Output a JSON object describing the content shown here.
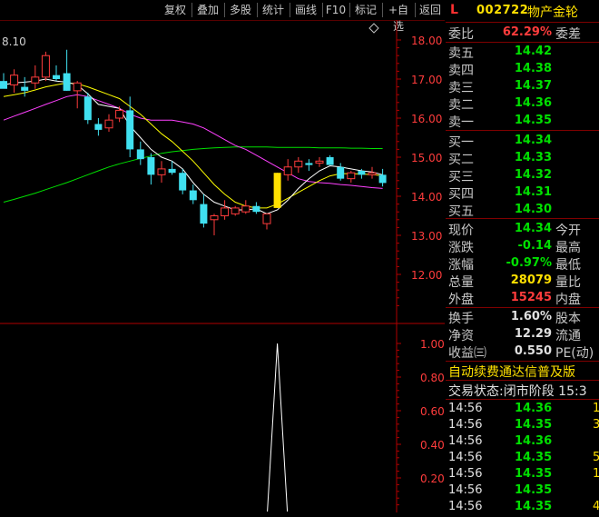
{
  "toolbar": {
    "buttons": [
      "复权",
      "叠加",
      "多股",
      "统计",
      "画线",
      "F10",
      "标记",
      "+自选",
      "返回"
    ]
  },
  "chart": {
    "top_left_label": "8.10",
    "corner_icon": "diamond-icon",
    "price_axis": [
      "18.00",
      "17.00",
      "16.00",
      "15.00",
      "14.00",
      "13.00",
      "12.00"
    ],
    "indicator_axis": [
      "1.00",
      "0.80",
      "0.60",
      "0.40",
      "0.20"
    ],
    "colors": {
      "up": "#ff3c3c",
      "down": "#40e0f0",
      "ma5": "#ffffff",
      "ma10": "#ffff00",
      "ma20": "#ff40ff",
      "ma60": "#00e000",
      "highlight": "#ffe000",
      "axis": "#b00000"
    }
  },
  "chart_data": {
    "type": "candlestick",
    "ylim": [
      11.5,
      18.2
    ],
    "candles": [
      {
        "o": 16.95,
        "h": 17.15,
        "l": 16.85,
        "c": 16.75
      },
      {
        "o": 16.85,
        "h": 17.25,
        "l": 16.65,
        "c": 17.1
      },
      {
        "o": 16.8,
        "h": 17.05,
        "l": 16.55,
        "c": 16.7
      },
      {
        "o": 16.9,
        "h": 17.35,
        "l": 16.75,
        "c": 17.05
      },
      {
        "o": 17.05,
        "h": 17.7,
        "l": 16.95,
        "c": 17.6
      },
      {
        "o": 17.1,
        "h": 17.35,
        "l": 16.95,
        "c": 17.0
      },
      {
        "o": 17.15,
        "h": 17.75,
        "l": 16.7,
        "c": 16.7
      },
      {
        "o": 16.7,
        "h": 16.95,
        "l": 16.25,
        "c": 16.9
      },
      {
        "o": 16.55,
        "h": 16.65,
        "l": 15.85,
        "c": 15.95
      },
      {
        "o": 15.85,
        "h": 16.0,
        "l": 15.55,
        "c": 15.7
      },
      {
        "o": 15.75,
        "h": 16.1,
        "l": 15.65,
        "c": 15.95
      },
      {
        "o": 16.0,
        "h": 16.3,
        "l": 15.9,
        "c": 16.2
      },
      {
        "o": 16.2,
        "h": 16.55,
        "l": 15.0,
        "c": 15.2
      },
      {
        "o": 15.2,
        "h": 15.4,
        "l": 14.8,
        "c": 14.95
      },
      {
        "o": 15.0,
        "h": 15.1,
        "l": 14.3,
        "c": 14.55
      },
      {
        "o": 14.55,
        "h": 14.9,
        "l": 14.35,
        "c": 14.7
      },
      {
        "o": 14.7,
        "h": 14.9,
        "l": 14.55,
        "c": 14.6
      },
      {
        "o": 14.6,
        "h": 14.7,
        "l": 14.05,
        "c": 14.15
      },
      {
        "o": 14.15,
        "h": 14.3,
        "l": 13.8,
        "c": 13.9
      },
      {
        "o": 13.8,
        "h": 14.05,
        "l": 13.2,
        "c": 13.3
      },
      {
        "o": 13.4,
        "h": 13.55,
        "l": 13.0,
        "c": 13.5
      },
      {
        "o": 13.5,
        "h": 13.9,
        "l": 13.4,
        "c": 13.7
      },
      {
        "o": 13.55,
        "h": 13.75,
        "l": 13.5,
        "c": 13.7
      },
      {
        "o": 13.6,
        "h": 13.9,
        "l": 13.55,
        "c": 13.75
      },
      {
        "o": 13.75,
        "h": 13.85,
        "l": 13.55,
        "c": 13.6
      },
      {
        "o": 13.3,
        "h": 13.55,
        "l": 13.15,
        "c": 13.55
      },
      {
        "o": 13.7,
        "h": 14.6,
        "l": 13.7,
        "c": 14.6
      },
      {
        "o": 14.55,
        "h": 14.95,
        "l": 14.4,
        "c": 14.75
      },
      {
        "o": 14.75,
        "h": 15.0,
        "l": 14.6,
        "c": 14.9
      },
      {
        "o": 14.85,
        "h": 14.95,
        "l": 14.65,
        "c": 14.8
      },
      {
        "o": 14.85,
        "h": 15.0,
        "l": 14.75,
        "c": 14.9
      },
      {
        "o": 15.0,
        "h": 15.05,
        "l": 14.8,
        "c": 14.8
      },
      {
        "o": 14.75,
        "h": 14.85,
        "l": 14.4,
        "c": 14.45
      },
      {
        "o": 14.45,
        "h": 14.65,
        "l": 14.35,
        "c": 14.6
      },
      {
        "o": 14.65,
        "h": 14.7,
        "l": 14.45,
        "c": 14.55
      },
      {
        "o": 14.55,
        "h": 14.75,
        "l": 14.45,
        "c": 14.6
      },
      {
        "o": 14.55,
        "h": 14.7,
        "l": 14.25,
        "c": 14.34
      }
    ],
    "ma_short": [
      16.85,
      16.9,
      16.92,
      16.95,
      17.0,
      16.95,
      16.92,
      16.85,
      16.62,
      16.35,
      16.3,
      16.25,
      15.8,
      15.5,
      15.2,
      15.0,
      14.9,
      14.7,
      14.35,
      14.05,
      13.85,
      13.75,
      13.65,
      13.65,
      13.68,
      13.55,
      13.65,
      13.9,
      14.2,
      14.45,
      14.65,
      14.78,
      14.75,
      14.7,
      14.65,
      14.62,
      14.55
    ],
    "ma_mid": [
      16.55,
      16.6,
      16.65,
      16.72,
      16.8,
      16.85,
      16.9,
      16.88,
      16.8,
      16.7,
      16.6,
      16.5,
      16.3,
      16.1,
      15.85,
      15.6,
      15.4,
      15.15,
      14.9,
      14.6,
      14.3,
      14.05,
      13.85,
      13.75,
      13.7,
      13.7,
      13.8,
      13.95,
      14.1,
      14.25,
      14.4,
      14.52,
      14.58,
      14.58,
      14.57,
      14.55,
      14.53
    ],
    "ma_long": [
      15.95,
      16.05,
      16.15,
      16.25,
      16.35,
      16.45,
      16.55,
      16.6,
      16.55,
      16.45,
      16.35,
      16.25,
      16.1,
      16.0,
      15.95,
      15.95,
      15.95,
      15.9,
      15.85,
      15.75,
      15.6,
      15.45,
      15.3,
      15.2,
      15.05,
      14.9,
      14.75,
      14.6,
      14.45,
      14.38,
      14.35,
      14.33,
      14.3,
      14.28,
      14.25,
      14.22,
      14.2
    ],
    "ma_longest": [
      13.85,
      13.92,
      14.0,
      14.08,
      14.17,
      14.26,
      14.35,
      14.45,
      14.55,
      14.65,
      14.75,
      14.83,
      14.9,
      14.97,
      15.03,
      15.1,
      15.14,
      15.17,
      15.2,
      15.22,
      15.24,
      15.25,
      15.26,
      15.26,
      15.26,
      15.26,
      15.25,
      15.25,
      15.25,
      15.25,
      15.24,
      15.24,
      15.24,
      15.23,
      15.23,
      15.22,
      15.22
    ],
    "highlight_index": 26,
    "indicator": {
      "ylim": [
        0,
        1.1
      ],
      "values": [
        0,
        0,
        0,
        0,
        0,
        0,
        0,
        0,
        0,
        0,
        0,
        0,
        0,
        0,
        0,
        0,
        0,
        0,
        0,
        0,
        0,
        0,
        0,
        0,
        0,
        0,
        1.0,
        0,
        0,
        0,
        0,
        0,
        0,
        0,
        0,
        0,
        0
      ]
    }
  },
  "header": {
    "market": "L",
    "code": "002722",
    "name": "物产金轮"
  },
  "quote": {
    "wei_bi_label": "委比",
    "wei_bi": "62.29%",
    "wei_cha_label": "委差",
    "asks": [
      {
        "label": "卖五",
        "price": "14.42"
      },
      {
        "label": "卖四",
        "price": "14.38"
      },
      {
        "label": "卖三",
        "price": "14.37"
      },
      {
        "label": "卖二",
        "price": "14.36"
      },
      {
        "label": "卖一",
        "price": "14.35"
      }
    ],
    "bids": [
      {
        "label": "买一",
        "price": "14.34"
      },
      {
        "label": "买二",
        "price": "14.33"
      },
      {
        "label": "买三",
        "price": "14.32"
      },
      {
        "label": "买四",
        "price": "14.31"
      },
      {
        "label": "买五",
        "price": "14.30"
      }
    ],
    "stats": [
      {
        "label": "现价",
        "value": "14.34",
        "label2": "今开",
        "color": "green"
      },
      {
        "label": "涨跌",
        "value": "-0.14",
        "label2": "最高",
        "color": "green"
      },
      {
        "label": "涨幅",
        "value": "-0.97%",
        "label2": "最低",
        "color": "green"
      },
      {
        "label": "总量",
        "value": "28079",
        "label2": "量比",
        "color": "yellow"
      },
      {
        "label": "外盘",
        "value": "15245",
        "label2": "内盘",
        "color": "red"
      }
    ],
    "fundamentals": [
      {
        "label": "换手",
        "value": "1.60%",
        "label2": "股本"
      },
      {
        "label": "净资",
        "value": "12.29",
        "label2": "流通"
      },
      {
        "label": "收益㈢",
        "value": "0.550",
        "label2": "PE(动)"
      }
    ],
    "banner": "自动续费通达信普及版",
    "status": "交易状态:闭市阶段 15:3",
    "ticks": [
      {
        "time": "14:56",
        "price": "14.36",
        "vol": "1"
      },
      {
        "time": "14:56",
        "price": "14.35",
        "vol": "3"
      },
      {
        "time": "14:56",
        "price": "14.36",
        "vol": ""
      },
      {
        "time": "14:56",
        "price": "14.35",
        "vol": "5"
      },
      {
        "time": "14:56",
        "price": "14.35",
        "vol": "1"
      },
      {
        "time": "14:56",
        "price": "14.35",
        "vol": ""
      },
      {
        "time": "14:56",
        "price": "14.35",
        "vol": "4"
      }
    ]
  }
}
